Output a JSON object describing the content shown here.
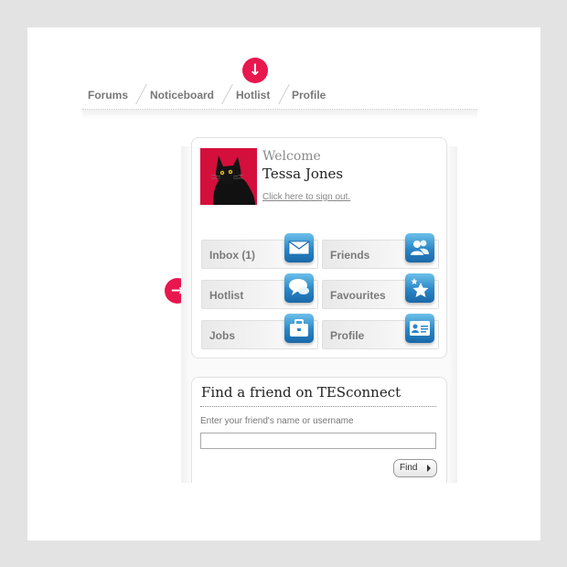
{
  "nav": {
    "items": [
      {
        "label": "Forums"
      },
      {
        "label": "Noticeboard"
      },
      {
        "label": "Hotlist"
      },
      {
        "label": "Profile"
      }
    ],
    "active_index": 2
  },
  "indicators": {
    "nav_marker_icon": "arrow-down-icon",
    "side_marker_icon": "arrow-right-icon",
    "color": "#e8174e"
  },
  "profile": {
    "welcome": "Welcome",
    "name": "Tessa Jones",
    "sign_out": "Click here to sign out.",
    "avatar_icon": "black-cat-avatar",
    "avatar_background": "#d40f3c"
  },
  "tiles": [
    {
      "label": "Inbox (1)",
      "icon": "envelope-icon"
    },
    {
      "label": "Friends",
      "icon": "people-icon"
    },
    {
      "label": "Hotlist",
      "icon": "speech-bubbles-icon"
    },
    {
      "label": "Favourites",
      "icon": "stars-icon"
    },
    {
      "label": "Jobs",
      "icon": "briefcase-icon"
    },
    {
      "label": "Profile",
      "icon": "id-card-icon"
    }
  ],
  "find_friend": {
    "title": "Find a friend on TESconnect",
    "label": "Enter your friend's name or username",
    "input_value": "",
    "button": "Find"
  },
  "colors": {
    "icon_blue": "#2a86c6",
    "accent": "#e8174e"
  }
}
